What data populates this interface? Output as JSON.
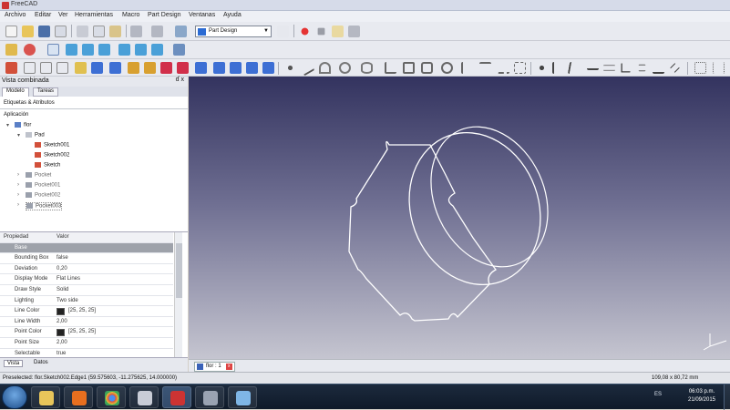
{
  "window": {
    "title": "FreeCAD"
  },
  "menu": [
    "Archivo",
    "Editar",
    "Ver",
    "Herramientas",
    "Macro",
    "Part Design",
    "Ventanas",
    "Ayuda"
  ],
  "toolbar": {
    "workbench_select": "Part Design"
  },
  "combo": {
    "title": "Vista combinada",
    "close": "ɗ x",
    "tabs": [
      "Modelo",
      "Tareas"
    ],
    "subheader": "Etiquetas & Atributos",
    "tree": {
      "root": "Aplicación",
      "doc": "flor",
      "body": "Pad",
      "items": [
        "Sketch001",
        "Sketch002",
        "Sketch",
        "Pocket",
        "Pocket001",
        "Pocket002",
        "Pocket003"
      ]
    }
  },
  "props": {
    "headers": [
      "Propiedad",
      "Valor"
    ],
    "group": "Base",
    "rows": [
      {
        "k": "Bounding Box",
        "v": "false"
      },
      {
        "k": "Deviation",
        "v": "0,20"
      },
      {
        "k": "Display Mode",
        "v": "Flat Lines"
      },
      {
        "k": "Draw Style",
        "v": "Solid"
      },
      {
        "k": "Lighting",
        "v": "Two side"
      },
      {
        "k": "Line Color",
        "v": "[25, 25, 25]",
        "swatch": true
      },
      {
        "k": "Line Width",
        "v": "2,00"
      },
      {
        "k": "Point Color",
        "v": "[25, 25, 25]",
        "swatch": true
      },
      {
        "k": "Point Size",
        "v": "2,00"
      },
      {
        "k": "Selectable",
        "v": "true"
      }
    ]
  },
  "bottom_tabs": [
    "Vista",
    "Datos"
  ],
  "mdi": {
    "tab": "flor : 1"
  },
  "status": {
    "text": "Preselected: flor.Sketch002.Edge1 (59.575603, -11.275625, 14.000000)",
    "dims": "109,08 x 80,72 mm"
  },
  "taskbar": {
    "tray": "ES",
    "time": "06:03 p.m.",
    "date": "21/09/2015"
  },
  "colors": {
    "viewport_top": "#33335f",
    "viewport_bottom": "#c5c5d0",
    "selected": "#3399ff"
  }
}
